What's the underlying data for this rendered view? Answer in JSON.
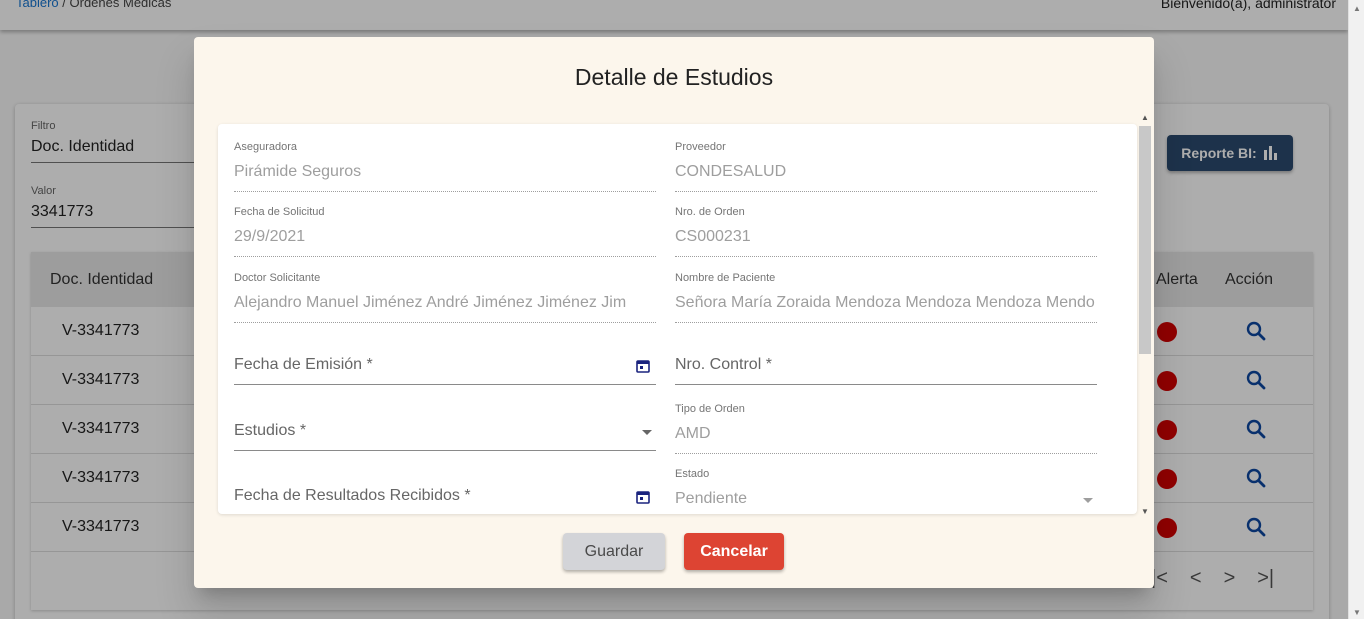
{
  "header": {
    "breadcrumb_home": "Tablero",
    "breadcrumb_sep": "/",
    "breadcrumb_current": "Ordenes Medicas",
    "welcome": "Bienvenido(a), administrator"
  },
  "filters": {
    "filter_label": "Filtro",
    "filter_value": "Doc. Identidad",
    "value_label": "Valor",
    "value_value": "3341773"
  },
  "report_button": {
    "label": "Reporte BI:",
    "icon": "bar-chart-icon"
  },
  "table": {
    "headers": {
      "doc": "Doc. Identidad",
      "alert": "Alerta",
      "action": "Acción"
    },
    "rows": [
      {
        "doc": "V-3341773"
      },
      {
        "doc": "V-3341773"
      },
      {
        "doc": "V-3341773"
      },
      {
        "doc": "V-3341773"
      },
      {
        "doc": "V-3341773"
      }
    ],
    "alert_color": "#d50000",
    "pager": {
      "first": "|<",
      "prev": "<",
      "next": ">",
      "last": ">|"
    }
  },
  "dialog": {
    "title": "Detalle de Estudios",
    "fields": {
      "aseguradora": {
        "label": "Aseguradora",
        "value": "Pirámide Seguros"
      },
      "proveedor": {
        "label": "Proveedor",
        "value": "CONDESALUD"
      },
      "fecha_solicitud": {
        "label": "Fecha de Solicitud",
        "value": "29/9/2021"
      },
      "nro_orden": {
        "label": "Nro. de Orden",
        "value": "CS000231"
      },
      "doctor": {
        "label": "Doctor Solicitante",
        "value": "Alejandro Manuel Jiménez André Jiménez Jiménez Jim"
      },
      "paciente": {
        "label": "Nombre de Paciente",
        "value": "Señora María Zoraida Mendoza Mendoza Mendoza Mendo"
      },
      "fecha_emision": {
        "placeholder": "Fecha de Emisión *"
      },
      "nro_control": {
        "placeholder": "Nro. Control *"
      },
      "estudios": {
        "placeholder": "Estudios *"
      },
      "tipo_orden": {
        "label": "Tipo de Orden",
        "value": "AMD"
      },
      "fecha_resultados": {
        "placeholder": "Fecha de Resultados Recibidos *"
      },
      "estado": {
        "label": "Estado",
        "value": "Pendiente"
      }
    },
    "buttons": {
      "save": "Guardar",
      "cancel": "Cancelar"
    },
    "colors": {
      "background": "#fcf6ec",
      "cancel": "#dd4433",
      "report": "#2b4a6f",
      "calendar_icon": "#1a237e"
    }
  }
}
